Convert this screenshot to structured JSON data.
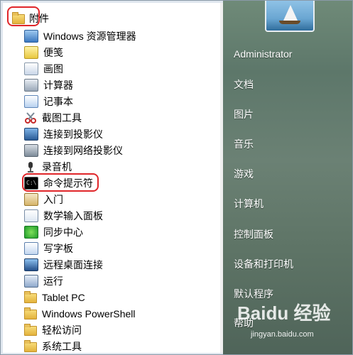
{
  "parent_folder": {
    "label": "附件",
    "icon": "folder-icon"
  },
  "menu_items": [
    {
      "label": "Windows 资源管理器",
      "icon": "explorer-icon",
      "color": "ic-blue"
    },
    {
      "label": "便笺",
      "icon": "sticky-notes-icon",
      "color": "ic-yellow"
    },
    {
      "label": "画图",
      "icon": "paint-icon",
      "color": "ic-paint"
    },
    {
      "label": "计算器",
      "icon": "calculator-icon",
      "color": "ic-calc"
    },
    {
      "label": "记事本",
      "icon": "notepad-icon",
      "color": "ic-note"
    },
    {
      "label": "截图工具",
      "icon": "scissors-icon",
      "color": "ic-scissor"
    },
    {
      "label": "连接到投影仪",
      "icon": "projector-icon",
      "color": "ic-proj"
    },
    {
      "label": "连接到网络投影仪",
      "icon": "network-projector-icon",
      "color": "ic-net"
    },
    {
      "label": "录音机",
      "icon": "microphone-icon",
      "color": "ic-mic"
    },
    {
      "label": "命令提示符",
      "icon": "command-prompt-icon",
      "color": "ic-cmd"
    },
    {
      "label": "入门",
      "icon": "getting-started-icon",
      "color": "ic-book"
    },
    {
      "label": "数学输入面板",
      "icon": "math-input-icon",
      "color": "ic-math"
    },
    {
      "label": "同步中心",
      "icon": "sync-center-icon",
      "color": "ic-sync"
    },
    {
      "label": "写字板",
      "icon": "wordpad-icon",
      "color": "ic-word"
    },
    {
      "label": "远程桌面连接",
      "icon": "remote-desktop-icon",
      "color": "ic-rdp"
    },
    {
      "label": "运行",
      "icon": "run-icon",
      "color": "ic-run"
    },
    {
      "label": "Tablet PC",
      "icon": "folder-icon",
      "color": "folder"
    },
    {
      "label": "Windows PowerShell",
      "icon": "folder-icon",
      "color": "folder"
    },
    {
      "label": "轻松访问",
      "icon": "folder-icon",
      "color": "folder"
    },
    {
      "label": "系统工具",
      "icon": "folder-icon",
      "color": "folder"
    }
  ],
  "right_panel": {
    "user": "Administrator",
    "items": [
      "文档",
      "图片",
      "音乐",
      "游戏",
      "计算机",
      "控制面板",
      "设备和打印机",
      "默认程序",
      "帮助"
    ]
  },
  "watermark": {
    "brand": "Baidu 经验",
    "url": "jingyan.baidu.com"
  },
  "colors": {
    "highlight": "#e0262a",
    "panel": "#6f8a78"
  }
}
